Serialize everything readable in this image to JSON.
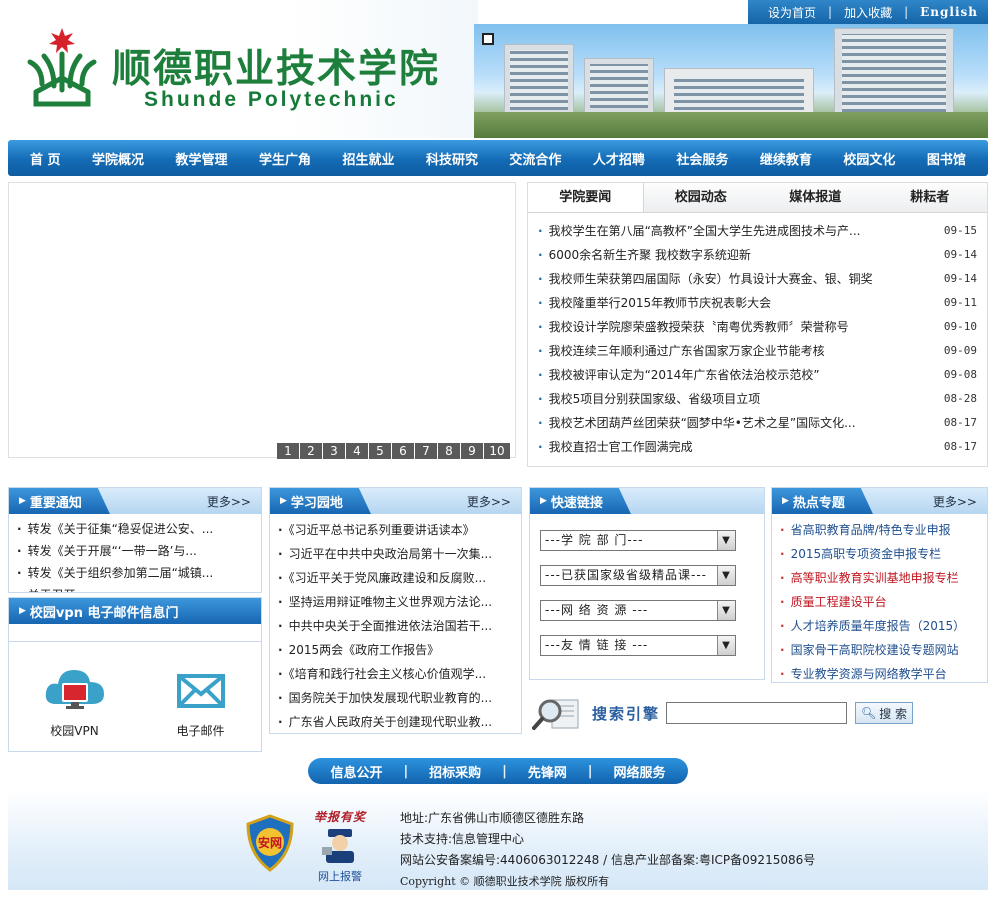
{
  "topbar": {
    "home": "设为首页",
    "favorite": "加入收藏",
    "english": "English",
    "sep": "|"
  },
  "header": {
    "title_cn": "顺德职业技术学院",
    "title_en": "Shunde Polytechnic"
  },
  "nav": [
    "首 页",
    "学院概况",
    "教学管理",
    "学生广角",
    "招生就业",
    "科技研究",
    "交流合作",
    "人才招聘",
    "社会服务",
    "继续教育",
    "校园文化",
    "图书馆"
  ],
  "slider": {
    "pages": [
      "1",
      "2",
      "3",
      "4",
      "5",
      "6",
      "7",
      "8",
      "9",
      "10"
    ]
  },
  "news": {
    "tabs": [
      "学院要闻",
      "校园动态",
      "媒体报道",
      "耕耘者"
    ],
    "items": [
      {
        "title": "我校学生在第八届“高教杯”全国大学生先进成图技术与产...",
        "date": "09-15"
      },
      {
        "title": "6000余名新生齐聚 我校数字系统迎新",
        "date": "09-14"
      },
      {
        "title": "我校师生荣获第四届国际（永安）竹具设计大赛金、银、铜奖",
        "date": "09-14"
      },
      {
        "title": "我校隆重举行2015年教师节庆祝表彰大会",
        "date": "09-11"
      },
      {
        "title": "我校设计学院廖荣盛教授荣获〝南粤优秀教师〞荣誉称号",
        "date": "09-10"
      },
      {
        "title": "我校连续三年顺利通过广东省国家万家企业节能考核",
        "date": "09-09"
      },
      {
        "title": "我校被评审认定为“2014年广东省依法治校示范校”",
        "date": "09-08"
      },
      {
        "title": "我校5项目分别获国家级、省级项目立项",
        "date": "08-28"
      },
      {
        "title": "我校艺术团葫芦丝团荣获“圆梦中华•艺术之星”国际文化...",
        "date": "08-17"
      },
      {
        "title": "我校直招士官工作圆满完成",
        "date": "08-17"
      }
    ]
  },
  "notice": {
    "title": "重要通知",
    "more": "更多>>",
    "items": [
      "转发《关于征集“稳妥促进公安、...",
      "转发《关于开展“‘一带一路’与...",
      "转发《关于组织参加第二届“城镇...",
      "关于召开..."
    ]
  },
  "vpn": {
    "title": "校园vpn  电子邮件信息门",
    "vpn_label": "校园VPN",
    "mail_label": "电子邮件"
  },
  "study": {
    "title": "学习园地",
    "more": "更多>>",
    "items": [
      "《习近平总书记系列重要讲话读本》",
      "习近平在中共中央政治局第十一次集...",
      "《习近平关于党风廉政建设和反腐败...",
      "坚持运用辩证唯物主义世界观方法论...",
      "中共中央关于全面推进依法治国若干...",
      "2015两会《政府工作报告》",
      "《培育和践行社会主义核心价值观学...",
      "国务院关于加快发展现代职业教育的...",
      "广东省人民政府关于创建现代职业教..."
    ]
  },
  "quick": {
    "title": "快速链接",
    "selects": [
      "---学 院 部 门---",
      "---已获国家级省级精品课---",
      "---网 络 资 源 ---",
      "---友 情 链 接 ---"
    ]
  },
  "hot": {
    "title": "热点专题",
    "more": "更多>>",
    "items": [
      {
        "text": "省高职教育品牌/特色专业申报",
        "color": "#1f4f8f"
      },
      {
        "text": "2015高职专项资金申报专栏",
        "color": "#1f4f8f"
      },
      {
        "text": "高等职业教育实训基地申报专栏",
        "color": "#c0161f"
      },
      {
        "text": "质量工程建设平台",
        "color": "#c0161f"
      },
      {
        "text": "人才培养质量年度报告（2015）",
        "color": "#1f4f8f"
      },
      {
        "text": "国家骨干高职院校建设专题网站",
        "color": "#1f4f8f"
      },
      {
        "text": "专业教学资源与网络教学平台",
        "color": "#1f4f8f"
      }
    ]
  },
  "search": {
    "label": "搜索引擎",
    "button": "搜 索"
  },
  "footnav": [
    "信息公开",
    "招标采购",
    "先锋网",
    "网络服务"
  ],
  "footer": {
    "address": "地址:广东省佛山市顺德区德胜东路",
    "support": "技术支持:信息管理中心",
    "icp": "网站公安备案编号:4406063012248 / 信息产业部备案:粤ICP备09215086号",
    "copyright": "Copyright ©  顺德职业技术学院 版权所有",
    "badge_report": "举报有奖",
    "badge_police": "网上报警",
    "badge_shield": "安网"
  },
  "colors": {
    "primary": "#1766b2",
    "green": "#1d7f3b",
    "red": "#c0161f"
  }
}
